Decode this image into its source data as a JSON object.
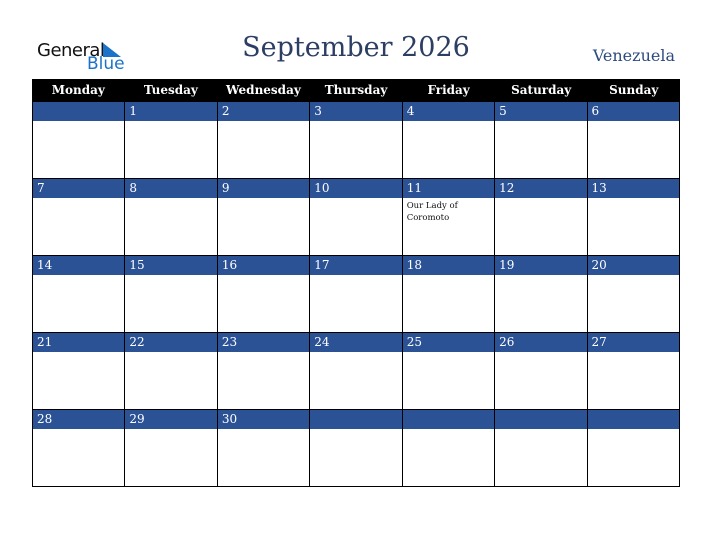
{
  "logo": {
    "line1": "General",
    "line2": "Blue"
  },
  "title": "September 2026",
  "country": "Venezuela",
  "days": [
    "Monday",
    "Tuesday",
    "Wednesday",
    "Thursday",
    "Friday",
    "Saturday",
    "Sunday"
  ],
  "weeks": [
    [
      {
        "d": ""
      },
      {
        "d": "1"
      },
      {
        "d": "2"
      },
      {
        "d": "3"
      },
      {
        "d": "4"
      },
      {
        "d": "5"
      },
      {
        "d": "6"
      }
    ],
    [
      {
        "d": "7"
      },
      {
        "d": "8"
      },
      {
        "d": "9"
      },
      {
        "d": "10"
      },
      {
        "d": "11",
        "e": "Our Lady of Coromoto"
      },
      {
        "d": "12"
      },
      {
        "d": "13"
      }
    ],
    [
      {
        "d": "14"
      },
      {
        "d": "15"
      },
      {
        "d": "16"
      },
      {
        "d": "17"
      },
      {
        "d": "18"
      },
      {
        "d": "19"
      },
      {
        "d": "20"
      }
    ],
    [
      {
        "d": "21"
      },
      {
        "d": "22"
      },
      {
        "d": "23"
      },
      {
        "d": "24"
      },
      {
        "d": "25"
      },
      {
        "d": "26"
      },
      {
        "d": "27"
      }
    ],
    [
      {
        "d": "28"
      },
      {
        "d": "29"
      },
      {
        "d": "30"
      },
      {
        "d": ""
      },
      {
        "d": ""
      },
      {
        "d": ""
      },
      {
        "d": ""
      }
    ]
  ],
  "colors": {
    "band": "#2c5296",
    "header": "#000000",
    "brand": "#1a73c8"
  }
}
